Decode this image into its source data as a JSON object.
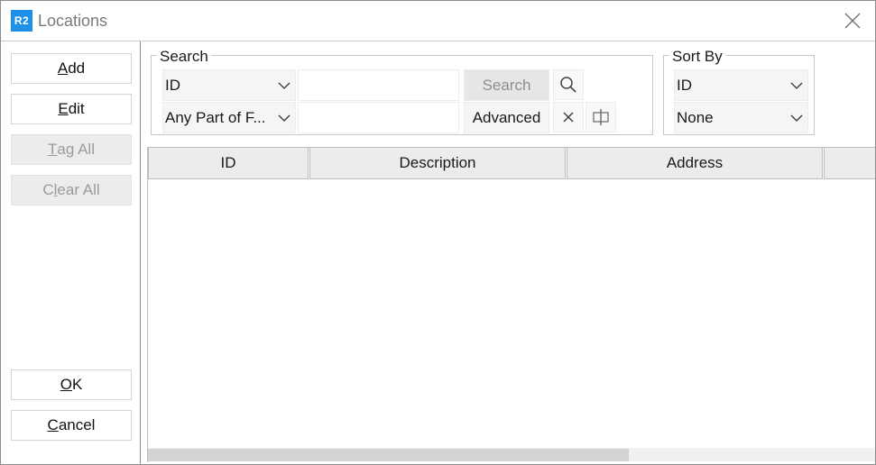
{
  "window": {
    "app_icon_text": "R2",
    "title": "Locations"
  },
  "sidebar": {
    "add": {
      "pre": "",
      "mn": "A",
      "post": "dd"
    },
    "edit": {
      "pre": "",
      "mn": "E",
      "post": "dit"
    },
    "tag_all": {
      "pre": "",
      "mn": "T",
      "post": "ag All"
    },
    "clear_all": {
      "pre": "C",
      "mn": "l",
      "post": "ear All"
    },
    "ok": {
      "pre": "",
      "mn": "O",
      "post": "K"
    },
    "cancel": {
      "pre": "",
      "mn": "C",
      "post": "ancel"
    }
  },
  "search": {
    "group_label": "Search",
    "field_select": "ID",
    "match_select": "Any Part of F...",
    "search_value": "",
    "advanced_value": "",
    "search_button": "Search",
    "advanced_button": "Advanced"
  },
  "sort": {
    "group_label": "Sort By",
    "primary": "ID",
    "secondary": "None"
  },
  "grid": {
    "columns": [
      "ID",
      "Description",
      "Address",
      ""
    ],
    "rows": [],
    "scroll_position": 0,
    "visible_fraction": 0.66
  },
  "icons": {
    "close": "close-icon",
    "search": "search-icon",
    "clear": "clear-x-icon",
    "columns": "column-layout-icon",
    "chevron": "chevron-down-icon"
  },
  "colors": {
    "accent": "#1e90e8",
    "disabled_text": "#9a9a9a",
    "header_bg": "#ececec"
  }
}
